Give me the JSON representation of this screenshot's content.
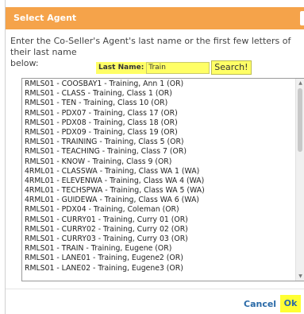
{
  "dialog": {
    "title": "Select Agent",
    "instructions": "Enter the Co-Seller's Agent's last name or the first few letters of their last name\nbelow:",
    "accent_color": "#f5a34a",
    "highlight_color": "#ffff66"
  },
  "search": {
    "label": "Last Name:",
    "value": "Train",
    "button_label": "Search!"
  },
  "results": [
    "RMLS01 - COOSBAY1 - Training, Ann 1 (OR)",
    "RMLS01 - CLASS - Training, Class 1 (OR)",
    "RMLS01 - TEN - Training, Class 10 (OR)",
    "RMLS01 - PDX07 - Training, Class 17 (OR)",
    "RMLS01 - PDX08 - Training, Class 18 (OR)",
    "RMLS01 - PDX09 - Training, Class 19 (OR)",
    "RMLS01 - TRAINING - Training, Class 5 (OR)",
    "RMLS01 - TEACHING - Training, Class 7 (OR)",
    "RMLS01 - KNOW - Training, Class 9 (OR)",
    "4RML01 - CLASSWA - Training, Class WA 1 (WA)",
    "4RML01 - ELEVENWA - Training, Class WA 4 (WA)",
    "4RML01 - TECHSPWA - Training, Class WA 5 (WA)",
    "4RML01 - GUIDEWA - Training, Class WA 6 (WA)",
    "RMLS01 - PDX04 - Training, Coleman (OR)",
    "RMLS01 - CURRY01 - Training, Curry 01 (OR)",
    "RMLS01 - CURRY02 - Training, Curry 02 (OR)",
    "RMLS01 - CURRY03 - Training, Curry 03 (OR)",
    "RMLS01 - TRAIN - Training, Eugene (OR)",
    "RMLS01 - LANE01 - Training, Eugene2 (OR)",
    "RMLS01 - LANE02 - Training, Eugene3 (OR)"
  ],
  "footer": {
    "cancel_label": "Cancel",
    "ok_label": "Ok"
  }
}
